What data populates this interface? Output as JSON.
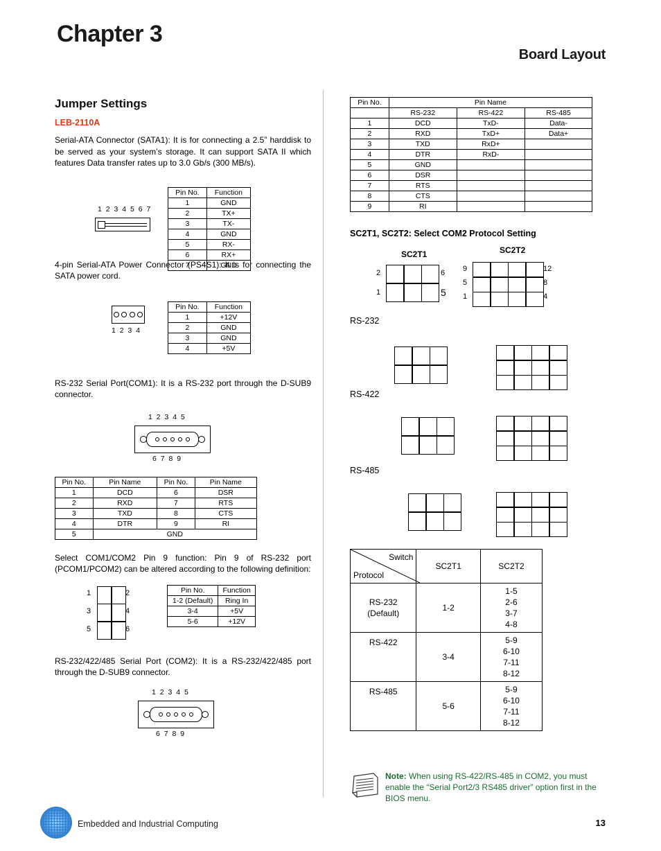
{
  "header": {
    "chapter": "Chapter 3",
    "board_layout": "Board Layout"
  },
  "left": {
    "section_title": "Jumper Settings",
    "model": "LEB-2110A",
    "para_sata": "Serial-ATA Connector (SATA1): It is for connecting a 2.5” harddisk to be served as your system’s storage.  It can support SATA II which features Data transfer rates up to 3.0 Gb/s (300 MB/s).",
    "sata_pins_label": "1 2 3 4 5 6 7",
    "sata_table": {
      "headers": [
        "Pin No.",
        "Function"
      ],
      "rows": [
        [
          "1",
          "GND"
        ],
        [
          "2",
          "TX+"
        ],
        [
          "3",
          "TX-"
        ],
        [
          "4",
          "GND"
        ],
        [
          "5",
          "RX-"
        ],
        [
          "6",
          "RX+"
        ],
        [
          "7",
          "GND"
        ]
      ]
    },
    "para_power": "4-pin Serial-ATA Power Connector (PS4S1):  It is for connecting the SATA power cord.",
    "power_pins_label": "1 2 3 4",
    "power_table": {
      "headers": [
        "Pin No.",
        "Function"
      ],
      "rows": [
        [
          "1",
          "+12V"
        ],
        [
          "2",
          "GND"
        ],
        [
          "3",
          "GND"
        ],
        [
          "4",
          "+5V"
        ]
      ]
    },
    "para_com1": "RS-232 Serial Port(COM1): It is a RS-232 port through the D-SUB9 connector.",
    "com1_top_label": "1 2 3 4 5",
    "com1_bottom_label": "6 7 8 9",
    "com1_table": {
      "headers": [
        "Pin No.",
        "Pin Name",
        "Pin No.",
        "Pin Name"
      ],
      "rows": [
        [
          "1",
          "DCD",
          "6",
          "DSR"
        ],
        [
          "2",
          "RXD",
          "7",
          "RTS"
        ],
        [
          "3",
          "TXD",
          "8",
          "CTS"
        ],
        [
          "4",
          "DTR",
          "9",
          "RI"
        ],
        [
          "5",
          "GND",
          "",
          ""
        ]
      ]
    },
    "para_pin9": "Select COM1/COM2 Pin 9 function: Pin 9 of RS-232 port (PCOM1/PCOM2) can be altered according to the following definition:",
    "pin9_jumper_labels": [
      "1",
      "2",
      "3",
      "4",
      "5",
      "6"
    ],
    "pin9_table": {
      "headers": [
        "Pin No.",
        "Function"
      ],
      "rows": [
        [
          "1-2 (Default)",
          "Ring In"
        ],
        [
          "3-4",
          "+5V"
        ],
        [
          "5-6",
          "+12V"
        ]
      ]
    },
    "para_com2": "RS-232/422/485 Serial Port (COM2):  It is a RS-232/422/485 port through the D-SUB9 connector.",
    "com2_top_label": "1 2 3 4 5",
    "com2_bottom_label": "6 7 8 9"
  },
  "right": {
    "pin_table": {
      "col1_header": "Pin No.",
      "group_header": "Pin Name",
      "sub_headers": [
        "RS-232",
        "RS-422",
        "RS-485"
      ],
      "rows": [
        [
          "1",
          "DCD",
          "TxD-",
          "Data-"
        ],
        [
          "2",
          "RXD",
          "TxD+",
          "Data+"
        ],
        [
          "3",
          "TXD",
          "RxD+",
          ""
        ],
        [
          "4",
          "DTR",
          "RxD-",
          ""
        ],
        [
          "5",
          "GND",
          "",
          ""
        ],
        [
          "6",
          "DSR",
          "",
          ""
        ],
        [
          "7",
          "RTS",
          "",
          ""
        ],
        [
          "8",
          "CTS",
          "",
          ""
        ],
        [
          "9",
          "RI",
          "",
          ""
        ]
      ]
    },
    "sc2_title": "SC2T1, SC2T2: Select COM2 Protocol Setting",
    "sc2t1_label": "SC2T1",
    "sc2t2_label": "SC2T2",
    "sc2t1_pin_labels": {
      "top_left": "2",
      "bottom_left": "1",
      "top_right": "6",
      "bottom_right": "5"
    },
    "sc2t2_pin_labels": {
      "left": [
        "9",
        "5",
        "1"
      ],
      "right": [
        "12",
        "8",
        "4"
      ]
    },
    "mode_labels": [
      "RS-232",
      "RS-422",
      "RS-485"
    ],
    "switch_table": {
      "corner_top": "Switch",
      "corner_bottom": "Protocol",
      "headers": [
        "SC2T1",
        "SC2T2"
      ],
      "rows": [
        {
          "protocol": "RS-232\n(Default)",
          "sc2t1": "1-2",
          "sc2t2": "1-5\n2-6\n3-7\n4-8"
        },
        {
          "protocol": "RS-422",
          "sc2t1": "3-4",
          "sc2t2": "5-9\n6-10\n7-11\n8-12"
        },
        {
          "protocol": "RS-485",
          "sc2t1": "5-6",
          "sc2t2": "5-9\n6-10\n7-11\n8-12"
        }
      ]
    },
    "note_label": "Note:",
    "note_text": "When using RS-422/RS-485 in COM2, you must enable the “Serial Port2/3 RS485 driver” option first in the BIOS menu."
  },
  "footer": {
    "tagline": "Embedded and Industrial Computing",
    "page_number": "13"
  }
}
